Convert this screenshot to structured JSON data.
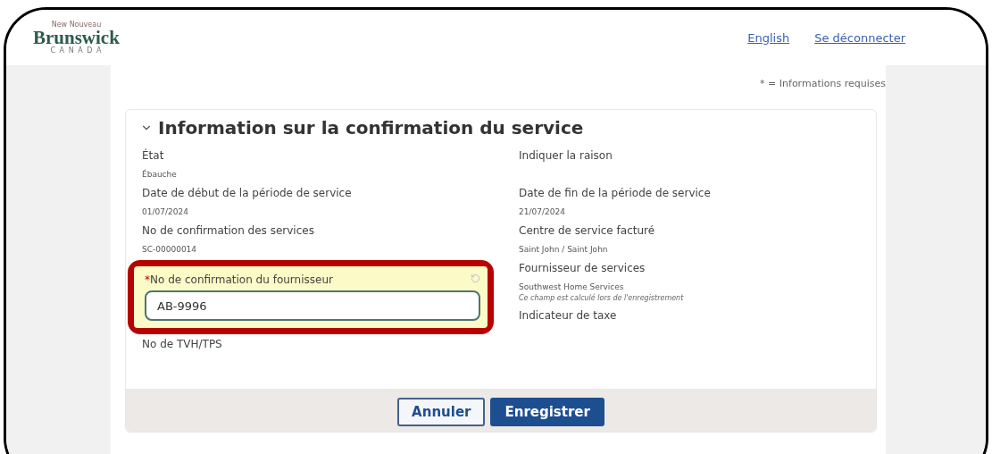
{
  "header": {
    "logo": {
      "top": "New Nouveau",
      "main": "Brunswick",
      "sub": "C A N A D A"
    },
    "links": [
      {
        "label": "English"
      },
      {
        "label": "Se déconnecter"
      }
    ]
  },
  "required_note": "* = Informations requises",
  "section": {
    "title": "Information sur la confirmation du service",
    "expanded": true,
    "left": [
      {
        "kind": "readonly",
        "label": "État",
        "value": "Ébauche"
      },
      {
        "kind": "readonly",
        "label": "Date de début de la période de service",
        "value": "01/07/2024"
      },
      {
        "kind": "readonly",
        "label": "No de confirmation des services",
        "value": "SC-00000014"
      },
      {
        "kind": "input",
        "required_mark": "*",
        "label": "No de confirmation du fournisseur",
        "value": "AB-9996",
        "highlighted": true
      },
      {
        "kind": "readonly",
        "label": "No de TVH/TPS"
      }
    ],
    "right": [
      {
        "kind": "readonly",
        "label": "Indiquer la raison"
      },
      {
        "kind": "readonly",
        "label": "Date de fin de la période de service",
        "value": "21/07/2024"
      },
      {
        "kind": "readonly",
        "label": "Centre de service facturé",
        "value": "Saint John / Saint John"
      },
      {
        "kind": "readonly",
        "label": "Fournisseur de services",
        "value": "Southwest Home Services",
        "note": "Ce champ est calculé lors de l'enregistrement"
      },
      {
        "kind": "readonly",
        "label": "Indicateur de taxe"
      }
    ]
  },
  "footer": {
    "buttons": [
      {
        "label": "Annuler",
        "kind": "secondary"
      },
      {
        "label": "Enregistrer",
        "kind": "primary"
      }
    ]
  }
}
